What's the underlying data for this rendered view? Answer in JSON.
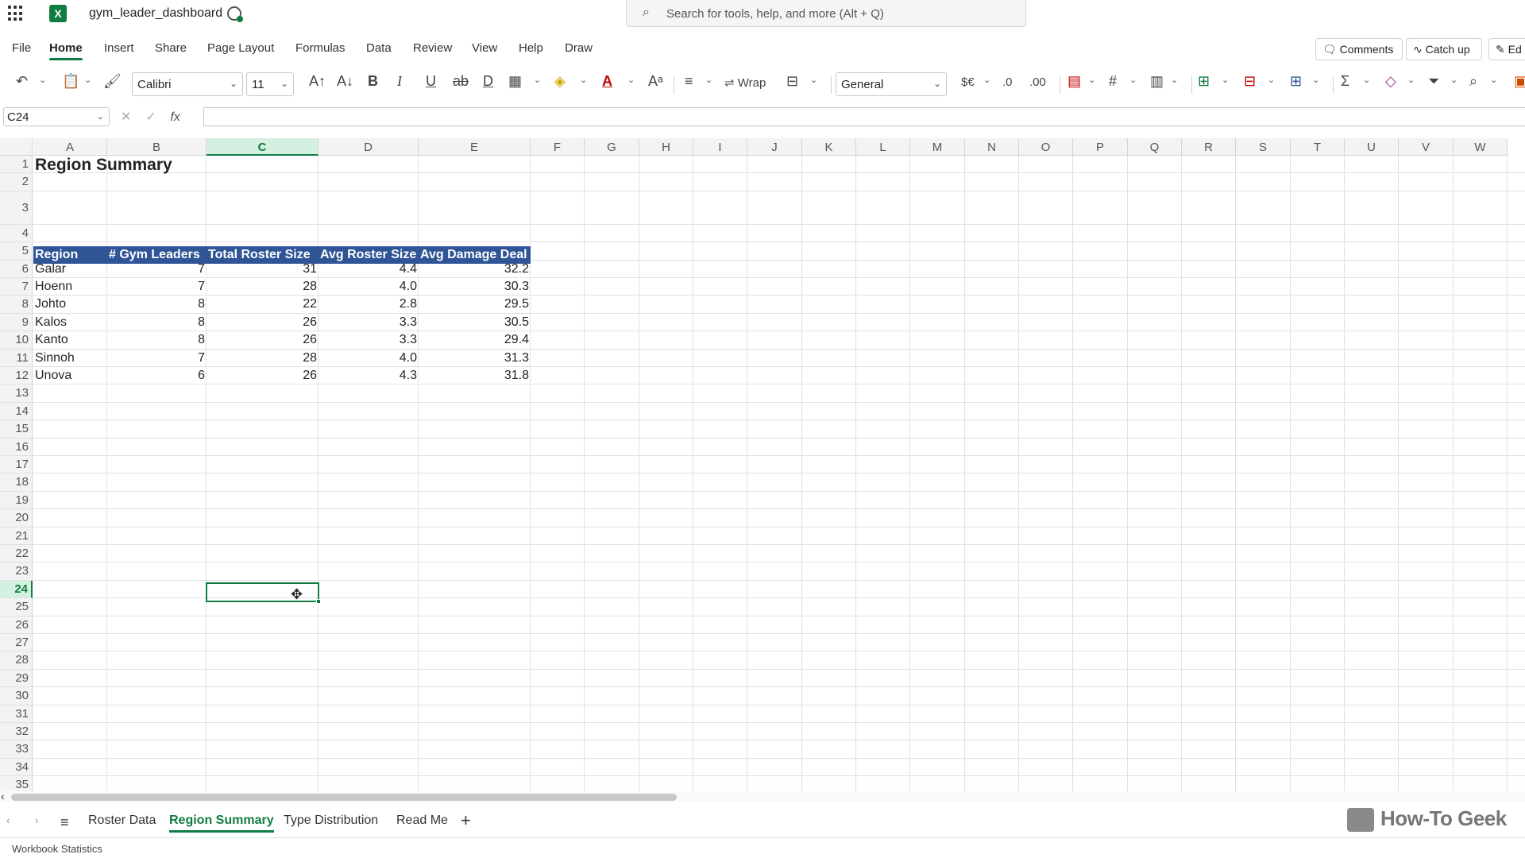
{
  "app": {
    "doc_title": "gym_leader_dashboard",
    "search_placeholder": "Search for tools, help, and more (Alt + Q)"
  },
  "menu": {
    "items": [
      "File",
      "Home",
      "Insert",
      "Share",
      "Page Layout",
      "Formulas",
      "Data",
      "Review",
      "View",
      "Help",
      "Draw"
    ],
    "active": "Home",
    "comments_label": "Comments",
    "catchup_label": "Catch up",
    "edit_label": "Ed"
  },
  "ribbon": {
    "font_name": "Calibri",
    "font_size": "11",
    "wrap_label": "Wrap",
    "number_format": "General",
    "currency_label": "$€"
  },
  "formula_bar": {
    "name_box": "C24",
    "fx_label": "fx",
    "value": ""
  },
  "grid": {
    "columns": [
      "A",
      "B",
      "C",
      "D",
      "E",
      "F",
      "G",
      "H",
      "I",
      "J",
      "K",
      "L",
      "M",
      "N",
      "O",
      "P",
      "Q",
      "R",
      "S",
      "T",
      "U",
      "V",
      "W"
    ],
    "selected_column": "C",
    "selected_row": "24",
    "rows": [
      "1",
      "2",
      "3",
      "4",
      "5",
      "6",
      "7",
      "8",
      "9",
      "10",
      "11",
      "12",
      "13",
      "14",
      "15",
      "16",
      "17",
      "18",
      "19",
      "20",
      "21",
      "22",
      "23",
      "24",
      "25",
      "26",
      "27",
      "28",
      "29",
      "30",
      "31",
      "32",
      "33",
      "34",
      "35"
    ]
  },
  "sheet": {
    "title": "Region Summary",
    "headers": [
      "Region",
      "# Gym Leaders",
      "Total Roster Size",
      "Avg Roster Size",
      "Avg Damage Deal"
    ],
    "rows": [
      [
        "Galar",
        "7",
        "31",
        "4.4",
        "32.2"
      ],
      [
        "Hoenn",
        "7",
        "28",
        "4.0",
        "30.3"
      ],
      [
        "Johto",
        "8",
        "22",
        "2.8",
        "29.5"
      ],
      [
        "Kalos",
        "8",
        "26",
        "3.3",
        "30.5"
      ],
      [
        "Kanto",
        "8",
        "26",
        "3.3",
        "29.4"
      ],
      [
        "Sinnoh",
        "7",
        "28",
        "4.0",
        "31.3"
      ],
      [
        "Unova",
        "6",
        "26",
        "4.3",
        "31.8"
      ]
    ],
    "header_color": "#2f5597"
  },
  "tabs": {
    "items": [
      "Roster Data",
      "Region Summary",
      "Type Distribution",
      "Read Me"
    ],
    "active": "Region Summary"
  },
  "status": {
    "text": "Workbook Statistics"
  },
  "watermark": "How-To Geek"
}
